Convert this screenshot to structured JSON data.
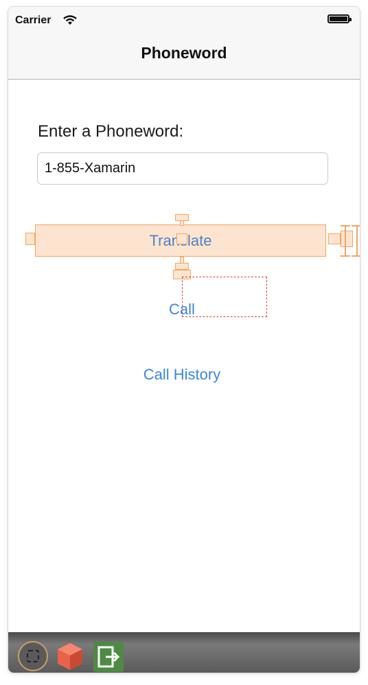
{
  "status_bar": {
    "carrier": "Carrier"
  },
  "navbar": {
    "title": "Phoneword"
  },
  "form": {
    "prompt": "Enter a Phoneword:",
    "phone_value": "1-855-Xamarin"
  },
  "buttons": {
    "translate": "Translate",
    "call": "Call",
    "call_history": "Call History"
  },
  "toolbar": {
    "tools": [
      "view-controller-icon",
      "first-responder-icon",
      "exit-icon"
    ]
  },
  "colors": {
    "link_blue": "#3a87d8",
    "selection_fill": "#fde4d0",
    "selection_stroke": "#f3a561",
    "exit_green": "#4e8a44"
  }
}
